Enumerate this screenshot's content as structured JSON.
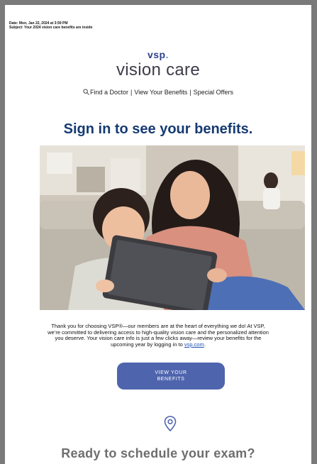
{
  "email": {
    "date": "Date: Mon, Jan 22, 2024 at 3:59 PM",
    "subject": "Subject: Your 2024 vision care benefits are inside"
  },
  "logo": {
    "mark_main": "vsp",
    "mark_dot": ".",
    "text": "vision care"
  },
  "nav": {
    "icon": "search-icon",
    "items": [
      "Find a Doctor",
      "View Your Benefits",
      "Special Offers"
    ],
    "separator": "|"
  },
  "headline": "Sign in to see your benefits.",
  "body": {
    "text": "Thank you for choosing VSP®—our members are at the heart of everything we do! At VSP, we’re committed to delivering access to high-quality vision care and the personalized attention you deserve. Your vision care info is just a few clicks away—review your benefits for the upcoming year by logging in to ",
    "link": "vsp.com",
    "end": "."
  },
  "cta": {
    "line1": "VIEW YOUR",
    "line2": "BENEFITS"
  },
  "location_icon": "location-pin-icon",
  "schedule_heading": "Ready to schedule your exam?",
  "colors": {
    "brand_navy": "#2f3f8c",
    "headline_blue": "#163b73",
    "cta_blue": "#4e64ad"
  }
}
